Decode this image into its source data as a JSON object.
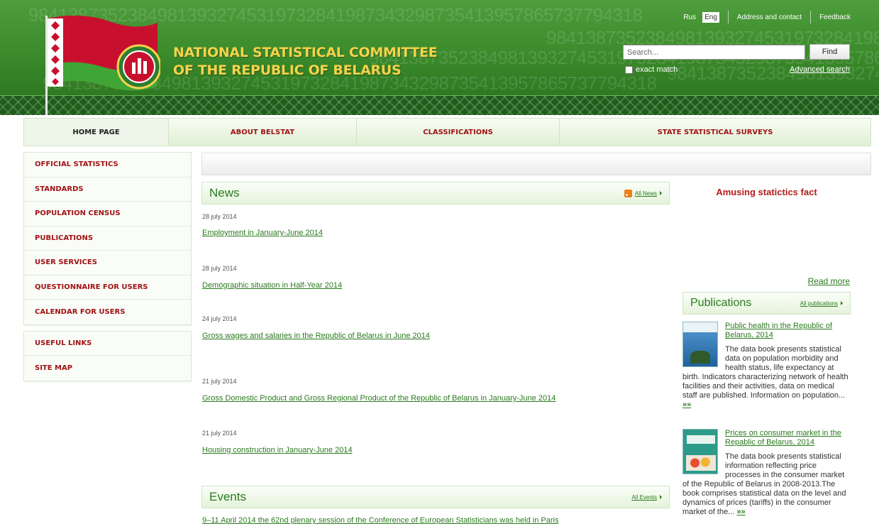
{
  "header": {
    "title_line1": "NATIONAL STATISTICAL COMMITTEE",
    "title_line2": "OF THE REPUBLIC OF BELARUS",
    "digits": "98413873523849813932745319732841987343298735413957865737794318",
    "lang_ru": "Rus",
    "lang_en": "Eng",
    "address_link": "Address and contact",
    "feedback_link": "Feedback",
    "search_placeholder": "Search...",
    "find_label": "Find",
    "exact_match_label": "exact match",
    "advanced_search_label": "Advanced search"
  },
  "nav": [
    {
      "label": "HOME PAGE",
      "active": true
    },
    {
      "label": "ABOUT BELSTAT"
    },
    {
      "label": "CLASSIFICATIONS"
    },
    {
      "label": "STATE STATISTICAL SURVEYS"
    }
  ],
  "sidebar": {
    "group1": [
      {
        "label": "OFFICIAL STATISTICS"
      },
      {
        "label": "STANDARDS"
      },
      {
        "label": "POPULATION CENSUS"
      },
      {
        "label": "PUBLICATIONS"
      },
      {
        "label": "USER SERVICES"
      },
      {
        "label": "QUESTIONNAIRE FOR USERS"
      },
      {
        "label": "CALENDAR FOR USERS"
      }
    ],
    "group2": [
      {
        "label": "USEFUL LINKS"
      },
      {
        "label": "SITE MAP"
      }
    ]
  },
  "news": {
    "title": "News",
    "all_link": "All News",
    "items": [
      {
        "date": "28 july 2014",
        "title": "Employment in January-June 2014"
      },
      {
        "date": "28 july 2014",
        "title": "Demographic situation in Half-Year 2014"
      },
      {
        "date": "24 july 2014",
        "title": "Gross wages and salaries in the Republic of Belarus in June 2014"
      },
      {
        "date": "21 july 2014",
        "title": "Gross Domestic Product and Gross Regional Product of the Republic of Belarus in January-June 2014"
      },
      {
        "date": "21 july 2014",
        "title": "Housing construction in January-June 2014"
      }
    ]
  },
  "events": {
    "title": "Events",
    "all_link": "All Events",
    "first_item": "9–11 April 2014 the 62nd plenary session of the Conference of European Statisticians was held in Paris"
  },
  "right": {
    "fact_title": "Amusing statictics fact",
    "read_more": "Read more",
    "publications_title": "Publications",
    "all_publications": "All publications",
    "pubs": [
      {
        "title": "Public health in the Republic of Belarus, 2014",
        "desc": "The data book presents statistical data on population morbidity and health status, life expectancy at birth. Indicators characterizing network of health facilities and their activities, data on medical staff are published. Information on population...",
        "more": "»»"
      },
      {
        "title": "Prices on consumer market in the Repablic of Belarus, 2014",
        "desc": "The data book presents statistical information reflecting price processes in the consumer market of the Republic of Belarus in 2008-2013.The book comprises statistical data on the level and dynamics of prices (tariffs) in the consumer market of the...",
        "more": "»»"
      }
    ]
  },
  "colors": {
    "header_green": "#3c8c2c",
    "title_yellow": "#f5d34a",
    "menu_red": "#a01414",
    "link_green": "#2a7a1e"
  }
}
